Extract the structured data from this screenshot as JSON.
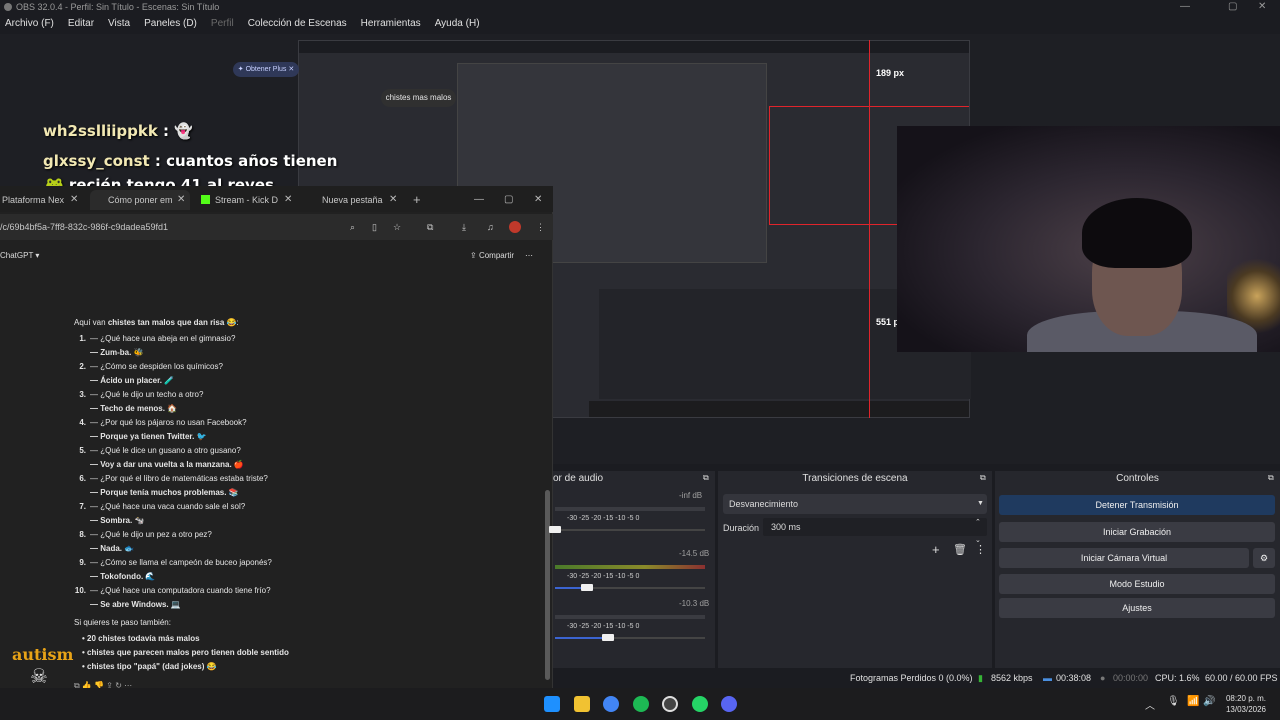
{
  "window": {
    "title": "OBS 32.0.4 - Perfil: Sin Título - Escenas: Sin Título",
    "controls": [
      "—",
      "▢",
      "✕"
    ]
  },
  "menu": [
    "Archivo (F)",
    "Editar",
    "Vista",
    "Paneles (D)",
    "Perfil",
    "Colección de Escenas",
    "Herramientas",
    "Ayuda (H)"
  ],
  "overlay": {
    "measure_top": "189 px",
    "measure_right": "551 p",
    "chat": [
      {
        "user": "wh2sslliippkk",
        "text": ""
      },
      {
        "user": "glxssy_const",
        "text": "cuantos años tienen"
      },
      {
        "user": "",
        "text": "recién tengo 41 al reves"
      }
    ],
    "logo_text": "autism"
  },
  "browser": {
    "tabs": [
      "Plataforma Nex",
      "Cómo poner em",
      "Stream - Kick De",
      "Nueva pestaña"
    ],
    "url": "/c/69b4bf5a-7ff8-832c-986f-c9dadea59fd1",
    "app_name": "ChatGPT",
    "plus_label": "Obtener Plus",
    "share_label": "Compartir",
    "user_message": "chistes mas malos",
    "intro_prefix": "Aquí van ",
    "intro_bold": "chistes tan malos que dan risa",
    "intro_suffix": " 😂:",
    "jokes": [
      {
        "n": "1.",
        "q": "— ¿Qué hace una abeja en el gimnasio?",
        "a": "— Zum-ba. 🐝"
      },
      {
        "n": "2.",
        "q": "— ¿Cómo se despiden los químicos?",
        "a": "— Ácido un placer. 🧪"
      },
      {
        "n": "3.",
        "q": "— ¿Qué le dijo un techo a otro?",
        "a": "— Techo de menos. 🏠"
      },
      {
        "n": "4.",
        "q": "— ¿Por qué los pájaros no usan Facebook?",
        "a": "— Porque ya tienen Twitter. 🐦"
      },
      {
        "n": "5.",
        "q": "— ¿Qué le dice un gusano a otro gusano?",
        "a": "— Voy a dar una vuelta a la manzana. 🍎"
      },
      {
        "n": "6.",
        "q": "— ¿Por qué el libro de matemáticas estaba triste?",
        "a": "— Porque tenía muchos problemas. 📚"
      },
      {
        "n": "7.",
        "q": "— ¿Qué hace una vaca cuando sale el sol?",
        "a": "— Sombra. 🐄"
      },
      {
        "n": "8.",
        "q": "— ¿Qué le dijo un pez a otro pez?",
        "a": "— Nada. 🐟"
      },
      {
        "n": "9.",
        "q": "— ¿Cómo se llama el campeón de buceo japonés?",
        "a": "— Tokofondo. 🌊"
      },
      {
        "n": "10.",
        "q": "— ¿Qué hace una computadora cuando tiene frío?",
        "a": "— Se abre Windows. 💻"
      }
    ],
    "outro": "Si quieres te paso también:",
    "bullets": [
      "20 chistes todavía más malos",
      "chistes que parecen malos pero tienen doble sentido",
      "chistes tipo \"papá\" (dad jokes) 😂"
    ]
  },
  "audio_mixer": {
    "title": "or de audio",
    "channels": [
      {
        "db": "-inf dB",
        "volume": 0.0
      },
      {
        "db": "-14.5 dB",
        "volume": 0.21
      },
      {
        "db": "-10.3 dB",
        "volume": 0.35
      }
    ],
    "ticks": "-30   -25   -20   -15   -10    -5     0"
  },
  "transitions": {
    "title": "Transiciones de escena",
    "selected": "Desvanecimiento",
    "duration_label": "Duración",
    "duration_value": "300 ms"
  },
  "controls": {
    "title": "Controles",
    "buttons": [
      "Detener Transmisión",
      "Iniciar Grabación",
      "Iniciar Cámara Virtual",
      "Modo Estudio",
      "Ajustes"
    ],
    "accent": "#1f3a5f"
  },
  "status": {
    "dropped": "Fotogramas Perdidos 0 (0.0%)",
    "bitrate": "8562 kbps",
    "stream_time": "00:38:08",
    "rec_time": "00:00:00",
    "cpu": "CPU: 1.6%",
    "fps": "60.00 / 60.00 FPS"
  },
  "taskbar": {
    "time": "08:20 p. m.",
    "date": "13/03/2026",
    "icons": [
      "windows-icon",
      "folder-icon",
      "chrome-icon",
      "spotify-icon",
      "obs-icon",
      "whatsapp-icon",
      "discord-icon"
    ]
  }
}
